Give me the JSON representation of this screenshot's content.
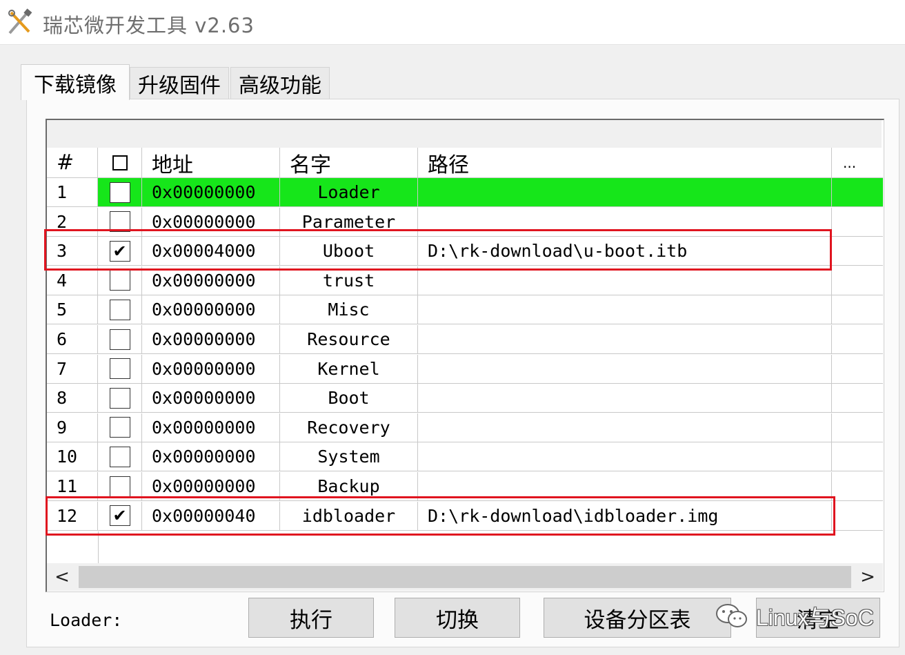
{
  "window": {
    "title": "瑞芯微开发工具 v2.63"
  },
  "tabs": [
    {
      "label": "下载镜像",
      "active": true
    },
    {
      "label": "升级固件",
      "active": false
    },
    {
      "label": "高级功能",
      "active": false
    }
  ],
  "table": {
    "headers": {
      "num": "#",
      "checkbox": "",
      "address": "地址",
      "name": "名字",
      "path": "路径",
      "more": "..."
    },
    "rows": [
      {
        "num": "1",
        "checked": false,
        "address": "0x00000000",
        "name": "Loader",
        "path": "",
        "highlighted": true
      },
      {
        "num": "2",
        "checked": false,
        "address": "0x00000000",
        "name": "Parameter",
        "path": ""
      },
      {
        "num": "3",
        "checked": true,
        "address": "0x00004000",
        "name": "Uboot",
        "path": "D:\\rk-download\\u-boot.itb"
      },
      {
        "num": "4",
        "checked": false,
        "address": "0x00000000",
        "name": "trust",
        "path": ""
      },
      {
        "num": "5",
        "checked": false,
        "address": "0x00000000",
        "name": "Misc",
        "path": ""
      },
      {
        "num": "6",
        "checked": false,
        "address": "0x00000000",
        "name": "Resource",
        "path": ""
      },
      {
        "num": "7",
        "checked": false,
        "address": "0x00000000",
        "name": "Kernel",
        "path": ""
      },
      {
        "num": "8",
        "checked": false,
        "address": "0x00000000",
        "name": "Boot",
        "path": ""
      },
      {
        "num": "9",
        "checked": false,
        "address": "0x00000000",
        "name": "Recovery",
        "path": ""
      },
      {
        "num": "10",
        "checked": false,
        "address": "0x00000000",
        "name": "System",
        "path": ""
      },
      {
        "num": "11",
        "checked": false,
        "address": "0x00000000",
        "name": "Backup",
        "path": ""
      },
      {
        "num": "12",
        "checked": true,
        "address": "0x00000040",
        "name": "idbloader",
        "path": "D:\\rk-download\\idbloader.img"
      }
    ],
    "highlight_color": "#16e61a",
    "annotation_color": "#e0141f"
  },
  "scrollbar": {
    "left_arrow": "<",
    "right_arrow": ">"
  },
  "bottom": {
    "loader_label": "Loader:",
    "buttons": {
      "execute": "执行",
      "switch": "切换",
      "partition_table": "设备分区表",
      "clear": "清空"
    }
  },
  "watermark": {
    "text": "Linux与SoC"
  }
}
